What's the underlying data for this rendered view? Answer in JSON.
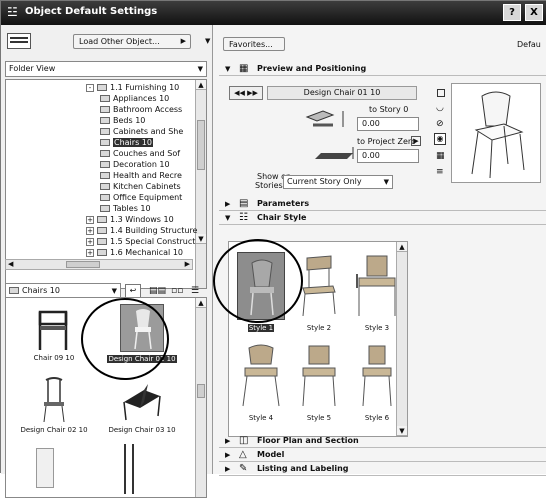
{
  "window": {
    "title": "Object Default Settings",
    "help_label": "?",
    "close_label": "X"
  },
  "left": {
    "load_other": "Load Other Object...",
    "folder_view": "Folder View",
    "tree": [
      {
        "label": "1.1 Furnishing 10",
        "indent": 1,
        "pm": "-"
      },
      {
        "label": "Appliances 10",
        "indent": 2
      },
      {
        "label": "Bathroom Access",
        "indent": 2
      },
      {
        "label": "Beds 10",
        "indent": 2
      },
      {
        "label": "Cabinets and She",
        "indent": 2
      },
      {
        "label": "Chairs 10",
        "indent": 2,
        "selected": true
      },
      {
        "label": "Couches and Sof",
        "indent": 2
      },
      {
        "label": "Decoration 10",
        "indent": 2
      },
      {
        "label": "Health and Recre",
        "indent": 2
      },
      {
        "label": "Kitchen Cabinets",
        "indent": 2
      },
      {
        "label": "Office Equipment",
        "indent": 2
      },
      {
        "label": "Tables 10",
        "indent": 2
      },
      {
        "label": "1.3 Windows 10",
        "indent": 1,
        "pm": "+"
      },
      {
        "label": "1.4 Building Structure",
        "indent": 1,
        "pm": "+"
      },
      {
        "label": "1.5 Special Construct",
        "indent": 1,
        "pm": "+"
      },
      {
        "label": "1.6 Mechanical 10",
        "indent": 1,
        "pm": "+"
      }
    ],
    "library_select": "Chairs 10",
    "thumbs": [
      {
        "label": "Chair 09 10"
      },
      {
        "label": "Design Chair 01 10",
        "selected": true
      },
      {
        "label": "Design Chair 02 10"
      },
      {
        "label": "Design Chair 03 10"
      }
    ]
  },
  "right": {
    "favorites": "Favorites...",
    "default_label": "Defau",
    "preview_title": "Preview and Positioning",
    "object_name": "Design Chair 01 10",
    "to_story": "to Story 0",
    "height1": "0.00",
    "to_project_zero": "to Project Zero",
    "height2": "0.00",
    "show_on_label": "Show on",
    "stories_label": "Stories:",
    "stories_value": "Current Story Only",
    "parameters": "Parameters",
    "chair_style": "Chair Style",
    "styles": [
      "Style 1",
      "Style 2",
      "Style 3",
      "Style 4",
      "Style 5",
      "Style 6"
    ],
    "floor_plan": "Floor Plan and Section",
    "model": "Model",
    "listing": "Listing and Labeling"
  }
}
